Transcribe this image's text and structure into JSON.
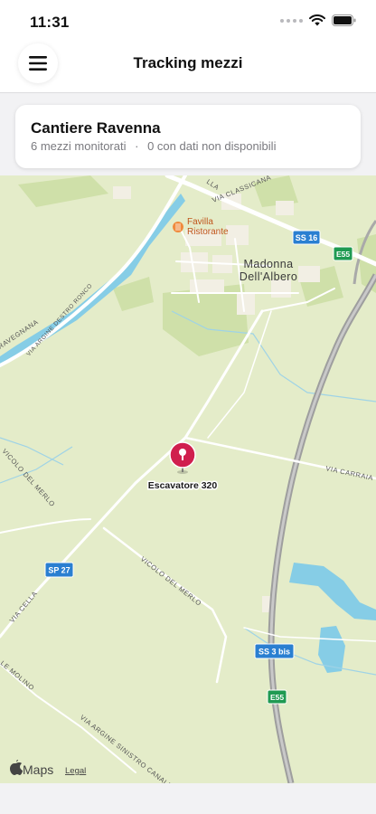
{
  "status": {
    "time": "11:31"
  },
  "header": {
    "title": "Tracking mezzi",
    "menu_icon": "hamburger-icon"
  },
  "site_card": {
    "title": "Cantiere Ravenna",
    "monitored": "6 mezzi monitorati",
    "separator": "·",
    "unavailable": "0 con dati non disponibili"
  },
  "map": {
    "pin": {
      "label": "Escavatore 320",
      "color": "#d01f4e"
    },
    "poi": {
      "name": "Favilla\nRistorante",
      "line1": "Favilla",
      "line2": "Ristorante"
    },
    "town": {
      "line1": "Madonna",
      "line2": "Dell'Albero"
    },
    "road_labels": {
      "via_classicana": "VIA CLASSICANA",
      "via_classicana_frag": "LLA",
      "ravegnana": "RAVEGNANA",
      "via_argine_destro_ronco": "VIA ARGINE DESTRO RONCO",
      "vicolo_del_merlo_1": "VICOLO DEL MERLO",
      "vicolo_del_merlo_2": "VICOLO DEL MERLO",
      "via_carraia": "VIA CARRAIA",
      "via_cella": "VIA CELLA",
      "le_molino": "LE MOLINO",
      "via_argine_sinistro": "VIA ARGINE SINISTRO CANALE"
    },
    "shields": {
      "ss16": "SS 16",
      "e55_top": "E55",
      "sp27": "SP 27",
      "ss3bis": "SS 3 bis",
      "e55_bottom": "E55"
    },
    "attribution": {
      "brand": "Maps",
      "legal": "Legal"
    },
    "colors": {
      "land": "#e4ecc9",
      "road": "#ffffff",
      "highway": "#a9a9a9",
      "water": "#86cde6",
      "shield": "#2a7fd1"
    }
  }
}
